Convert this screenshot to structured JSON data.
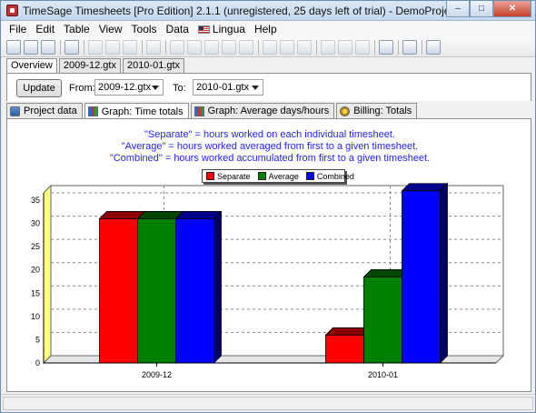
{
  "window": {
    "title": "TimeSage Timesheets [Pro Edition] 2.1.1 (unregistered, 25 days left of trial) - DemoProject.tsp",
    "buttons": {
      "minimize": "–",
      "maximize": "□",
      "close": "✕"
    }
  },
  "menu": [
    "File",
    "Edit",
    "Table",
    "View",
    "Tools",
    "Data",
    "Lingua",
    "Help"
  ],
  "document_tabs": [
    "Overview",
    "2009-12.gtx",
    "2010-01.gtx"
  ],
  "controls": {
    "update_label": "Update",
    "from_label": "From:",
    "from_value": "2009-12.gtx",
    "to_label": "To:",
    "to_value": "2010-01.gtx"
  },
  "view_tabs": [
    "Project data",
    "Graph: Time totals",
    "Graph: Average days/hours",
    "Billing: Totals"
  ],
  "notes": [
    "\"Separate\" = hours worked on each individual timesheet.",
    "\"Average\" = hours worked averaged from first to a given timesheet.",
    "\"Combined\" = hours worked accumulated from first to a given timesheet."
  ],
  "chart_data": {
    "type": "bar",
    "categories": [
      "2009-12",
      "2010-01"
    ],
    "series": [
      {
        "name": "Separate",
        "color": "#ff0000",
        "values": [
          31,
          6
        ]
      },
      {
        "name": "Average",
        "color": "#008000",
        "values": [
          31,
          18.5
        ]
      },
      {
        "name": "Combined",
        "color": "#0000ff",
        "values": [
          31,
          37
        ]
      }
    ],
    "ylim": [
      0,
      35
    ],
    "yticks": [
      0,
      5,
      10,
      15,
      20,
      25,
      30,
      35
    ],
    "grid": true,
    "legend_position": "top-center",
    "style": "3d"
  }
}
